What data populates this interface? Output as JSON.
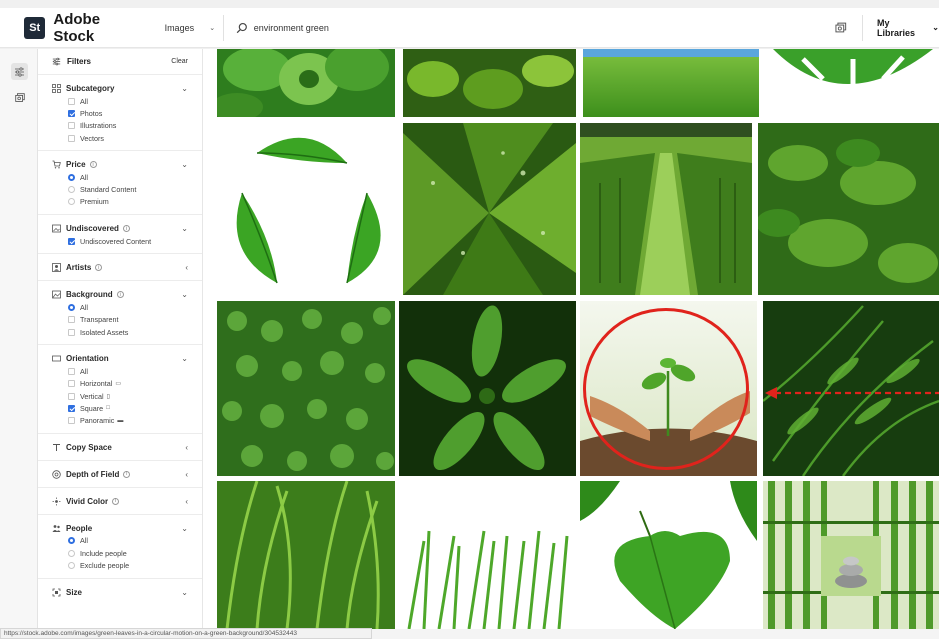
{
  "header": {
    "logo_badge": "St",
    "app_title": "Adobe Stock",
    "asset_type": "Images",
    "search_value": "environment green",
    "my_libraries": "My Libraries"
  },
  "filters": {
    "title": "Filters",
    "clear": "Clear",
    "subcategory": {
      "title": "Subcategory",
      "options": [
        "All",
        "Photos",
        "Illustrations",
        "Vectors"
      ]
    },
    "price": {
      "title": "Price",
      "options": [
        "All",
        "Standard Content",
        "Premium"
      ]
    },
    "undiscovered": {
      "title": "Undiscovered",
      "options": [
        "Undiscovered Content"
      ]
    },
    "artists": {
      "title": "Artists"
    },
    "background": {
      "title": "Background",
      "options": [
        "All",
        "Transparent",
        "Isolated Assets"
      ]
    },
    "orientation": {
      "title": "Orientation",
      "options": [
        "All",
        "Horizontal",
        "Vertical",
        "Square",
        "Panoramic"
      ]
    },
    "copy_space": {
      "title": "Copy Space"
    },
    "depth_of_field": {
      "title": "Depth of Field"
    },
    "vivid_color": {
      "title": "Vivid Color"
    },
    "people": {
      "title": "People",
      "options": [
        "All",
        "Include people",
        "Exclude people"
      ]
    },
    "size": {
      "title": "Size"
    }
  },
  "status_url": "https://stock.adobe.com/images/green-leaves-in-a-circular-motion-on-a-green-background/304532443",
  "colors": {
    "accent_blue": "#2f6fe0",
    "annotation_red": "#e0231c",
    "logo_dark": "#1f2a38"
  }
}
